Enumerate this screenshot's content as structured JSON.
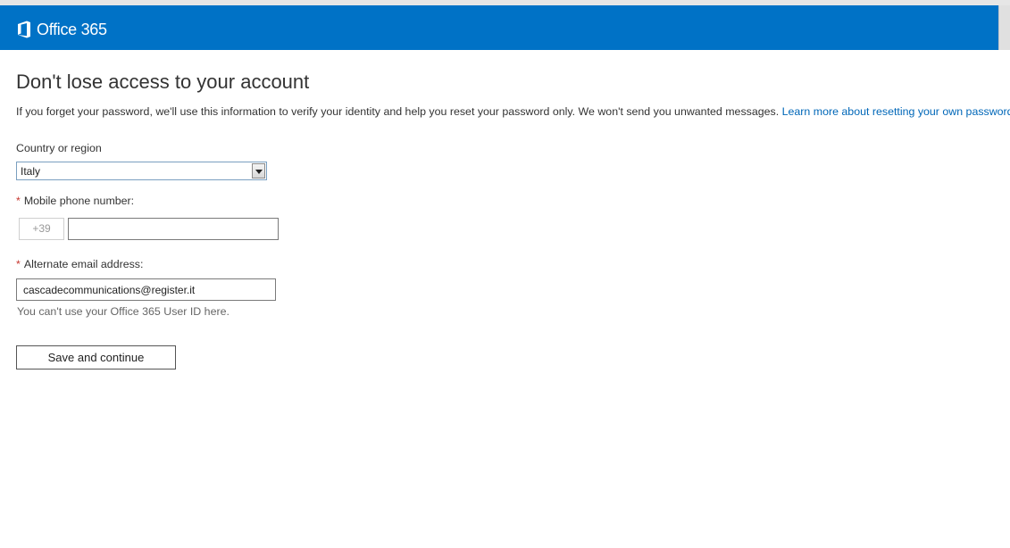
{
  "header": {
    "brand": "Office 365",
    "accent_color": "#0072c6",
    "logo_icon": "office-logo-icon"
  },
  "page": {
    "title": "Don't lose access to your account",
    "info_text": "If you forget your password, we'll use this information to verify your identity and help you reset your password only. We won't send you unwanted messages.",
    "learn_more_link": "Learn more about resetting your own password"
  },
  "form": {
    "country_label": "Country or region",
    "country_value": "Italy",
    "required_marker": "*",
    "mobile_label": "Mobile phone number:",
    "mobile_prefix": "+39",
    "mobile_value": "",
    "email_label": "Alternate email address:",
    "email_value": "cascadecommunications@register.it",
    "email_hint": "You can't use your Office 365 User ID here.",
    "save_label": "Save and continue"
  }
}
